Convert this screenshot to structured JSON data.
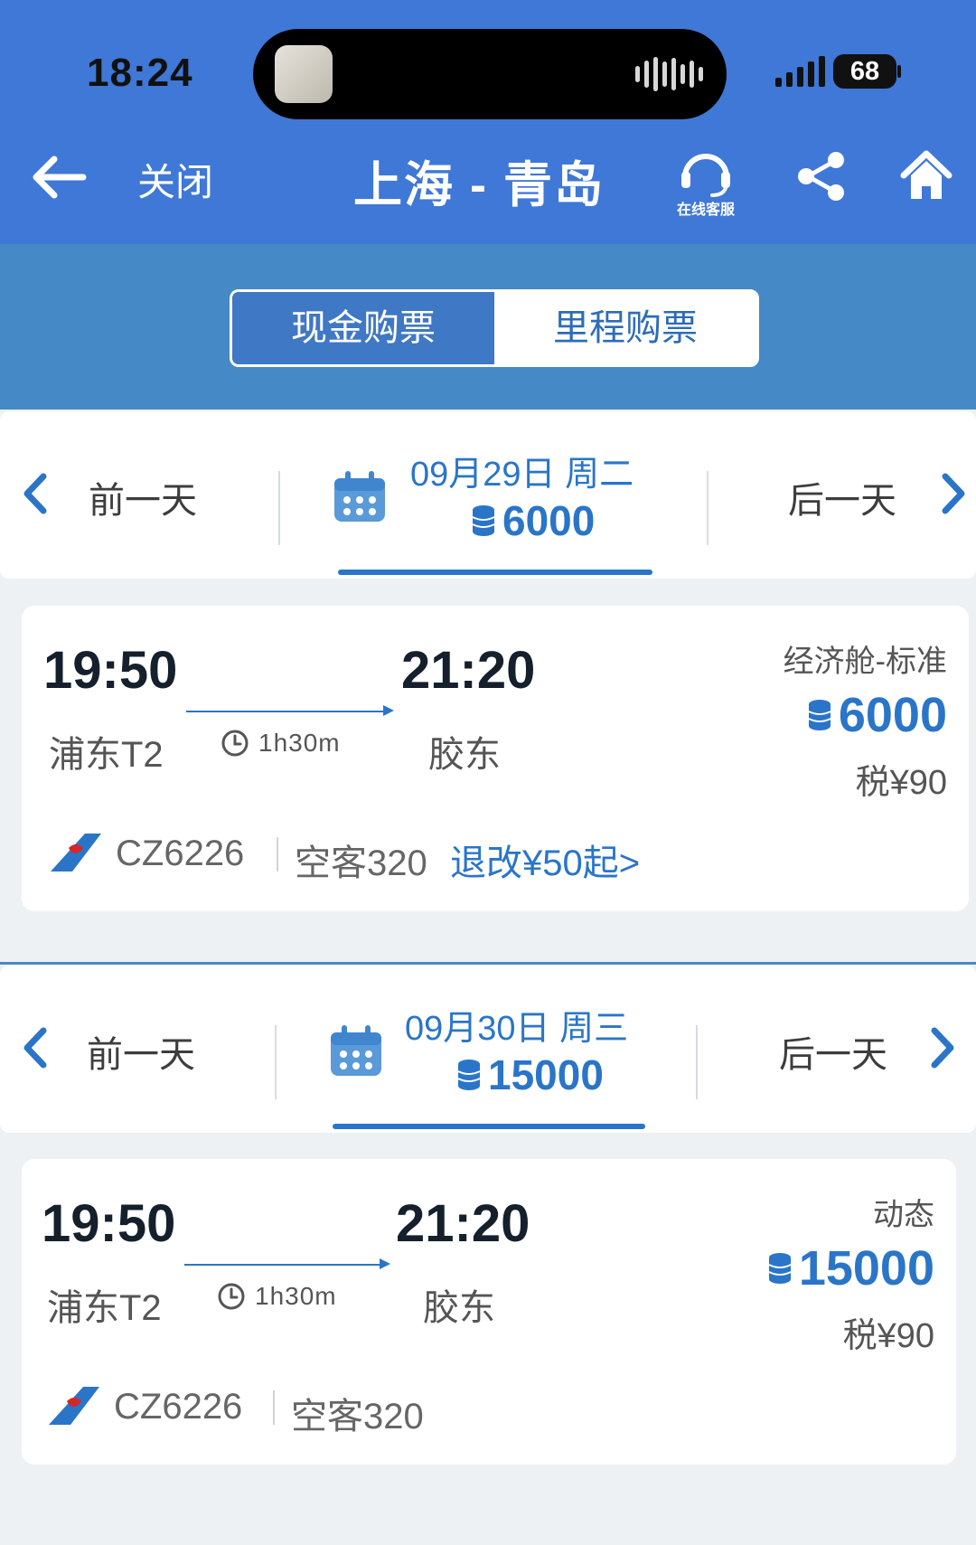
{
  "status_bar": {
    "time": "18:24",
    "battery": "68"
  },
  "nav": {
    "close_label": "关闭",
    "title": "上海 - 青岛",
    "service_label": "在线客服"
  },
  "segment": {
    "cash_label": "现金购票",
    "miles_label": "里程购票",
    "active": "现金购票"
  },
  "days": [
    {
      "prev_label": "前一天",
      "next_label": "后一天",
      "date": "09月29日 周二",
      "min_price": "6000",
      "flight": {
        "dep_time": "19:50",
        "arr_time": "21:20",
        "dep_airport": "浦东T2",
        "arr_airport": "胶东",
        "duration": "1h30m",
        "cabin": "经济舱-标准",
        "price": "6000",
        "tax": "税¥90",
        "flight_no": "CZ6226",
        "aircraft": "空客320",
        "refund": "退改¥50起>"
      }
    },
    {
      "prev_label": "前一天",
      "next_label": "后一天",
      "date": "09月30日 周三",
      "min_price": "15000",
      "flight": {
        "dep_time": "19:50",
        "arr_time": "21:20",
        "dep_airport": "浦东T2",
        "arr_airport": "胶东",
        "duration": "1h30m",
        "cabin": "动态",
        "price": "15000",
        "tax": "税¥90",
        "flight_no": "CZ6226",
        "aircraft": "空客320"
      }
    }
  ],
  "icons": {
    "back": "back-arrow-icon",
    "service": "headset-icon",
    "share": "share-icon",
    "home": "home-icon",
    "calendar": "calendar-icon",
    "miles": "coin-stack-icon",
    "clock": "clock-icon",
    "airline": "china-southern-logo"
  },
  "colors": {
    "header": "#3f78d6",
    "segment_bar": "#4589c6",
    "accent": "#2a75c8",
    "background": "#eef1f4"
  }
}
